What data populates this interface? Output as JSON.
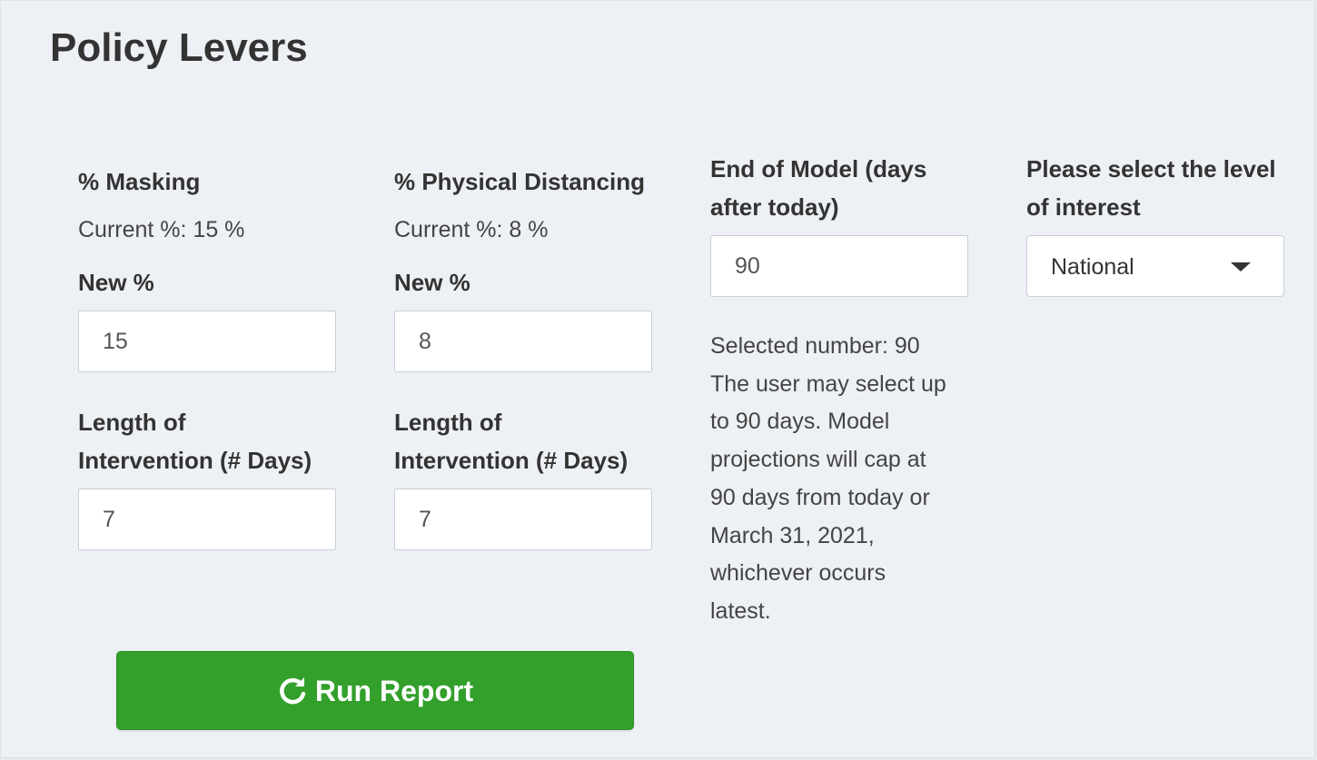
{
  "title": "Policy Levers",
  "masking": {
    "label": "% Masking",
    "current": "Current %: 15 %",
    "new_label": "New %",
    "new_value": "15",
    "length_label_line1": "Length of",
    "length_label_line2": "Intervention (# Days)",
    "length_value": "7"
  },
  "distancing": {
    "label": "% Physical Distancing",
    "current": "Current %: 8 %",
    "new_label": "New %",
    "new_value": "8",
    "length_label_line1": "Length of",
    "length_label_line2": "Intervention (# Days)",
    "length_value": "7"
  },
  "end_of_model": {
    "label_line1": "End of Model (days",
    "label_line2": "after today)",
    "value": "90",
    "note_lines": [
      "Selected number: 90",
      "The user may select up",
      "to 90 days. Model",
      "projections will cap at",
      "90 days from today or",
      "March 31, 2021,",
      "whichever occurs",
      "latest."
    ]
  },
  "level": {
    "label_line1": "Please select the level",
    "label_line2": "of interest",
    "selected": "National"
  },
  "run_button": {
    "label": "Run Report",
    "icon": "refresh-icon"
  },
  "colors": {
    "button_green": "#33a02c",
    "panel_bg": "#edf0f4"
  }
}
